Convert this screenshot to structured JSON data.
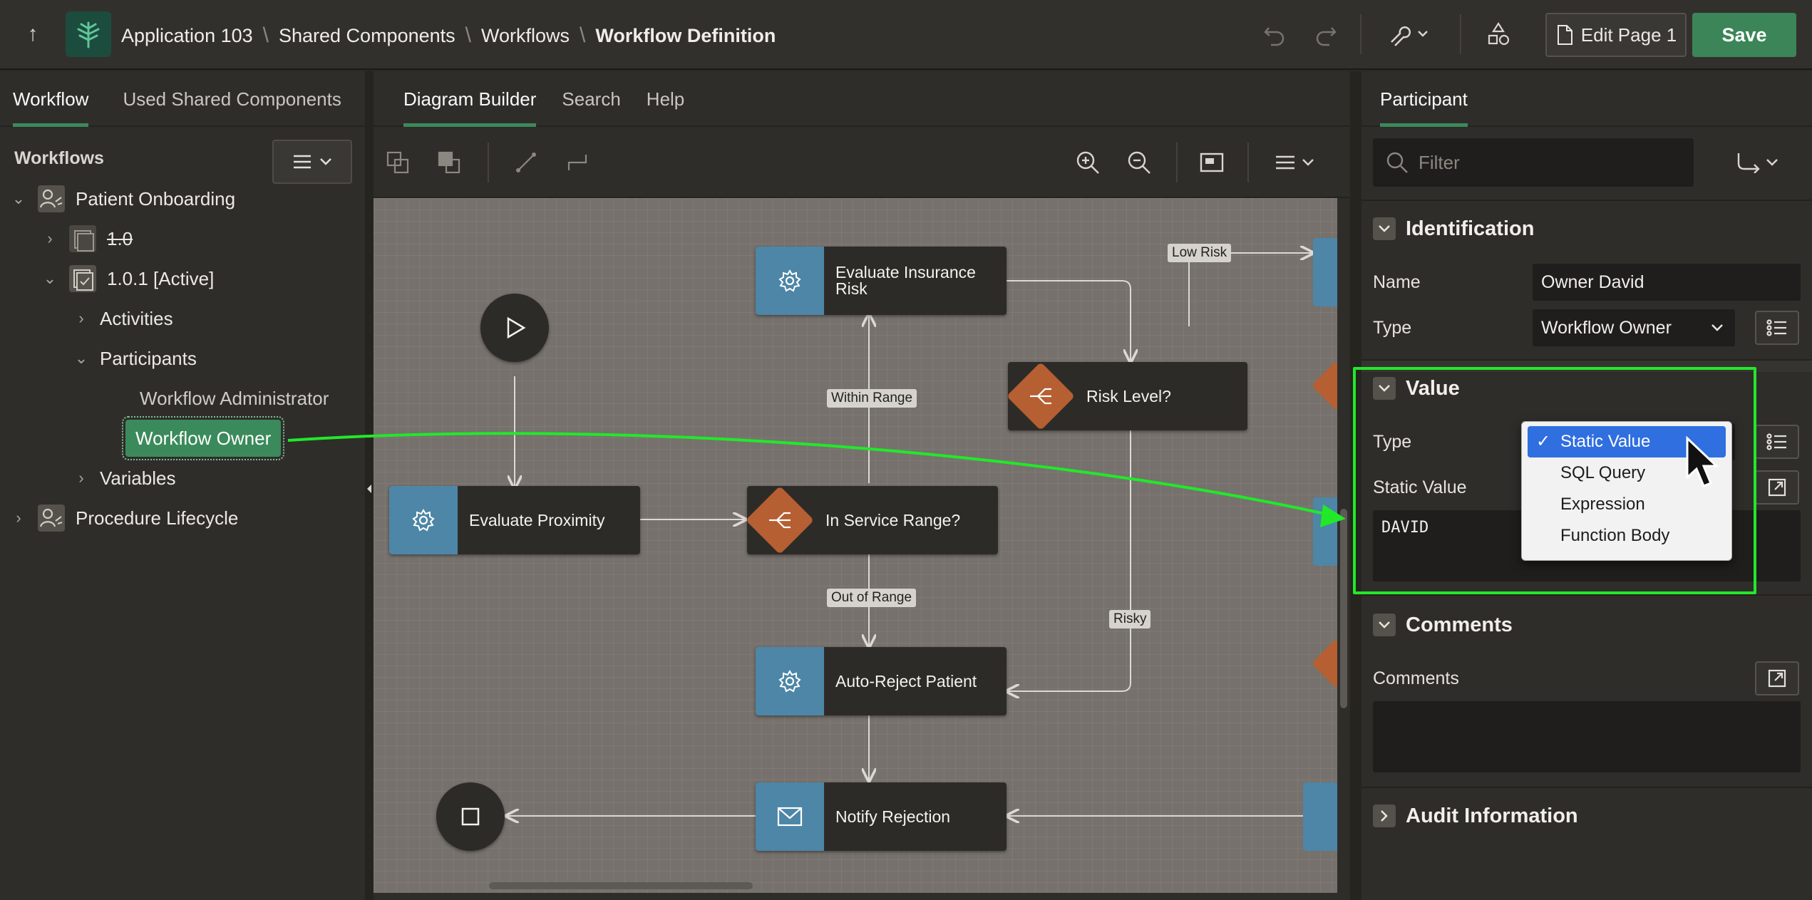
{
  "breadcrumb": [
    "Application 103",
    "Shared Components",
    "Workflows",
    "Workflow Definition"
  ],
  "header": {
    "edit_page_label": "Edit Page 1",
    "save_label": "Save"
  },
  "left": {
    "tabs": [
      "Workflow",
      "Used Shared Components"
    ],
    "section_title": "Workflows",
    "tree": {
      "patient_onboarding": "Patient Onboarding",
      "version_old": "1.0",
      "version_active": "1.0.1 [Active]",
      "activities": "Activities",
      "participants": "Participants",
      "workflow_admin": "Workflow Administrator",
      "workflow_owner": "Workflow Owner",
      "variables": "Variables",
      "procedure_lifecycle": "Procedure Lifecycle"
    }
  },
  "center": {
    "tabs": [
      "Diagram Builder",
      "Search",
      "Help"
    ],
    "nodes": {
      "evaluate_insurance_risk": "Evaluate Insurance Risk",
      "risk_level": "Risk Level?",
      "evaluate_proximity": "Evaluate Proximity",
      "in_service_range": "In Service Range?",
      "auto_reject_patient": "Auto-Reject Patient",
      "notify_rejection": "Notify Rejection"
    },
    "edge_labels": {
      "low_risk": "Low Risk",
      "within_range": "Within Range",
      "out_of_range": "Out of Range",
      "risky": "Risky"
    }
  },
  "right": {
    "tab": "Participant",
    "filter_placeholder": "Filter",
    "identification": {
      "title": "Identification",
      "name_label": "Name",
      "name_value": "Owner David",
      "type_label": "Type",
      "type_value": "Workflow Owner"
    },
    "value": {
      "title": "Value",
      "type_label": "Type",
      "static_value_label": "Static Value",
      "static_value": "DAVID",
      "options": [
        "Static Value",
        "SQL Query",
        "Expression",
        "Function Body"
      ],
      "selected_option": "Static Value"
    },
    "comments": {
      "title": "Comments",
      "label": "Comments"
    },
    "audit": {
      "title": "Audit Information"
    }
  },
  "colors": {
    "accent_green": "#3b8a5b",
    "highlight_green": "#22e82a",
    "activity_blue": "#4d86a6",
    "switch_orange": "#b55f32",
    "dropdown_selected": "#2f6fe0"
  }
}
